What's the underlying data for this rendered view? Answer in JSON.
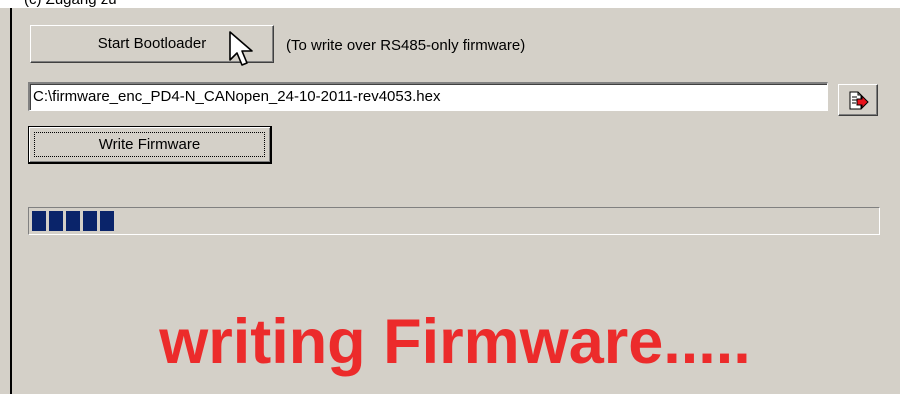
{
  "top_strip_text": "(c) Zugang zu",
  "bootloader": {
    "button_label": "Start Bootloader",
    "hint": "(To write over RS485-only firmware)"
  },
  "firmware": {
    "file_path": "C:\\firmware_enc_PD4-N_CANopen_24-10-2011-rev4053.hex",
    "browse_icon": "file-open-arrow-icon",
    "write_button_label": "Write Firmware"
  },
  "progress": {
    "blocks_filled": 5,
    "block_color": "#0a246a"
  },
  "status_message": "writing Firmware.....",
  "colors": {
    "panel_bg": "#d4d0c8",
    "status_text": "#ec2b2b"
  }
}
